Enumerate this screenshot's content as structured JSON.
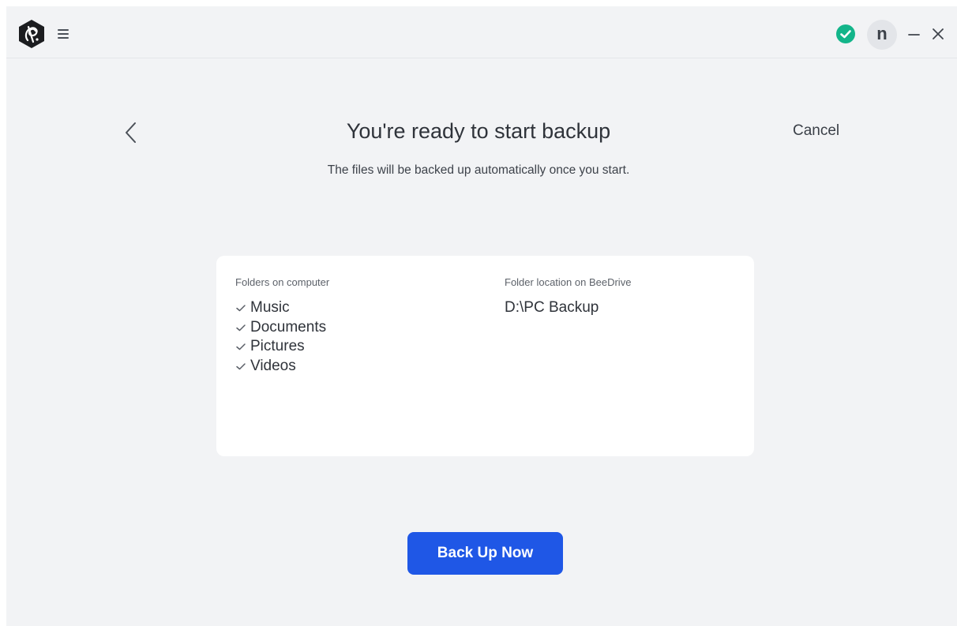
{
  "titlebar": {
    "avatar_initial": "n"
  },
  "page": {
    "title": "You're ready to start backup",
    "cancel_label": "Cancel",
    "subtitle": "The files will be backed up automatically once you start."
  },
  "card": {
    "left_label": "Folders on computer",
    "right_label": "Folder location on BeeDrive",
    "folders": [
      "Music",
      "Documents",
      "Pictures",
      "Videos"
    ],
    "location": "D:\\PC Backup"
  },
  "actions": {
    "primary_label": "Back Up Now"
  },
  "colors": {
    "accent": "#1f57e6",
    "status_ok": "#13b58a",
    "background": "#f2f3f5",
    "card": "#ffffff"
  },
  "icons": {
    "logo": "beedrive-logo-icon",
    "menu": "hamburger-menu-icon",
    "status": "check-circle-icon",
    "minimize": "minimize-icon",
    "close": "close-icon",
    "back": "chevron-left-icon",
    "item_check": "check-icon"
  }
}
